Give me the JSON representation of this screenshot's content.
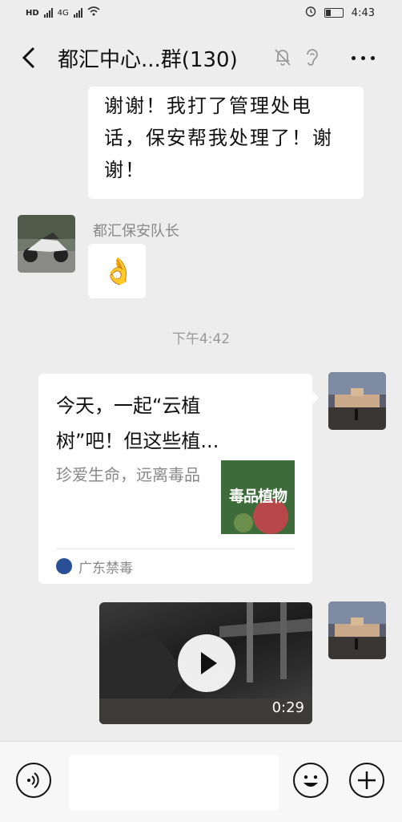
{
  "status_bar": {
    "time": "4:43",
    "net_left": "HD",
    "net_right": "4G"
  },
  "header": {
    "title": "都汇中心...群(130)"
  },
  "messages": {
    "m1_text": "谢谢！我打了管理处电话，保安帮我处理了！谢谢！",
    "m2_sender": "都汇保安队长",
    "m2_emoji": "👌",
    "time_divider": "下午4:42",
    "card": {
      "title": "今天，一起“云植树”吧！但这些植...",
      "desc": "珍爱生命，远离毒品",
      "thumb_text": "毒品植物",
      "source": "广东禁毒"
    },
    "video": {
      "duration": "0:29"
    }
  },
  "colors": {
    "bg": "#ededed",
    "bubble": "#ffffff",
    "accent": "#111111"
  }
}
